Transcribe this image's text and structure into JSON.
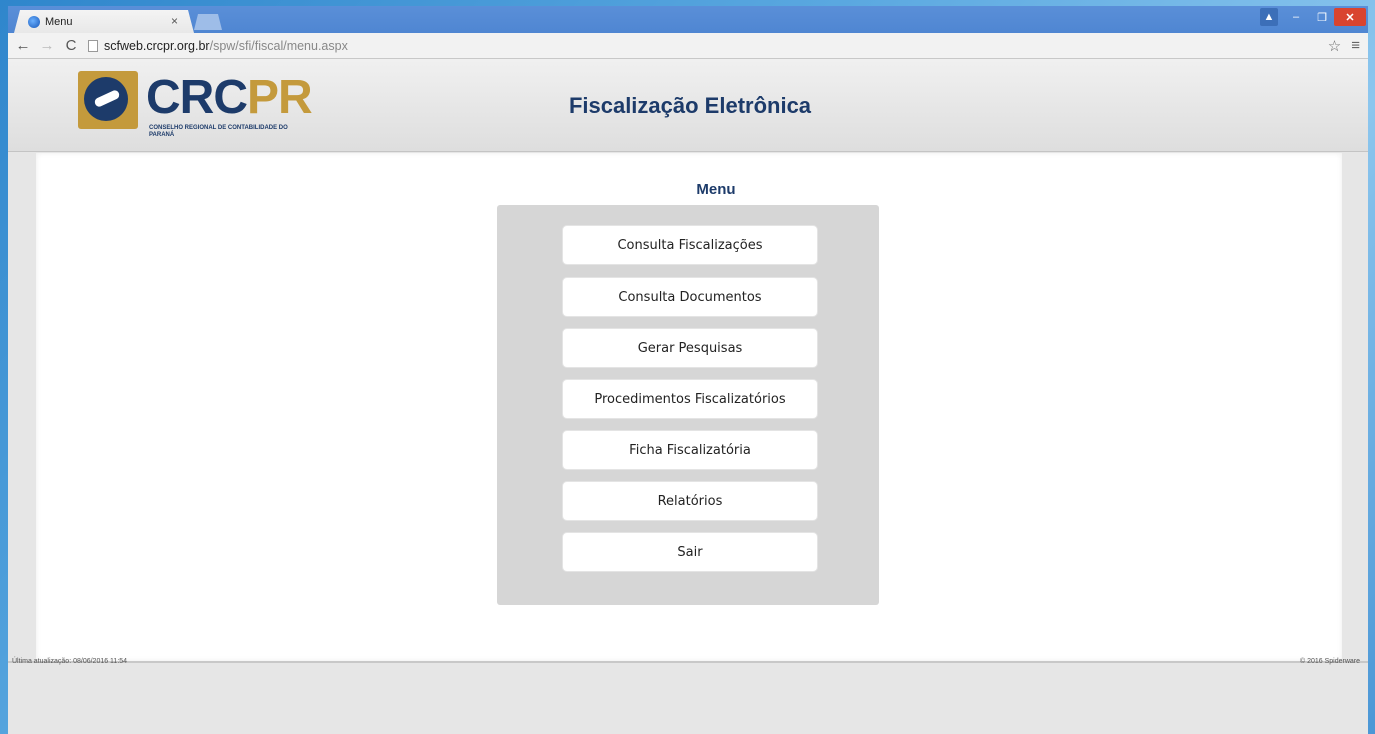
{
  "browser": {
    "tab_title": "Menu",
    "tab_close": "×",
    "url_host": "scfweb.crcpr.org.br",
    "url_path": "/spw/sfi/fiscal/menu.aspx",
    "controls": {
      "minimize": "–",
      "maximize": "❐",
      "close": "✕"
    }
  },
  "header": {
    "logo_left": "CRC",
    "logo_right": "PR",
    "logo_subtitle": "CONSELHO REGIONAL DE CONTABILIDADE DO PARANÁ",
    "app_title": "Fiscalização Eletrônica"
  },
  "menu": {
    "title": "Menu",
    "items": [
      "Consulta Fiscalizações",
      "Consulta Documentos",
      "Gerar Pesquisas",
      "Procedimentos Fiscalizatórios",
      "Ficha Fiscalizatória",
      "Relatórios",
      "Sair"
    ]
  },
  "footer": {
    "last_update": "Última atualização: 08/06/2016 11:54",
    "copyright": "© 2016 Spiderware"
  },
  "colors": {
    "brand_navy": "#1d3b6a",
    "brand_gold": "#c49a3c"
  }
}
